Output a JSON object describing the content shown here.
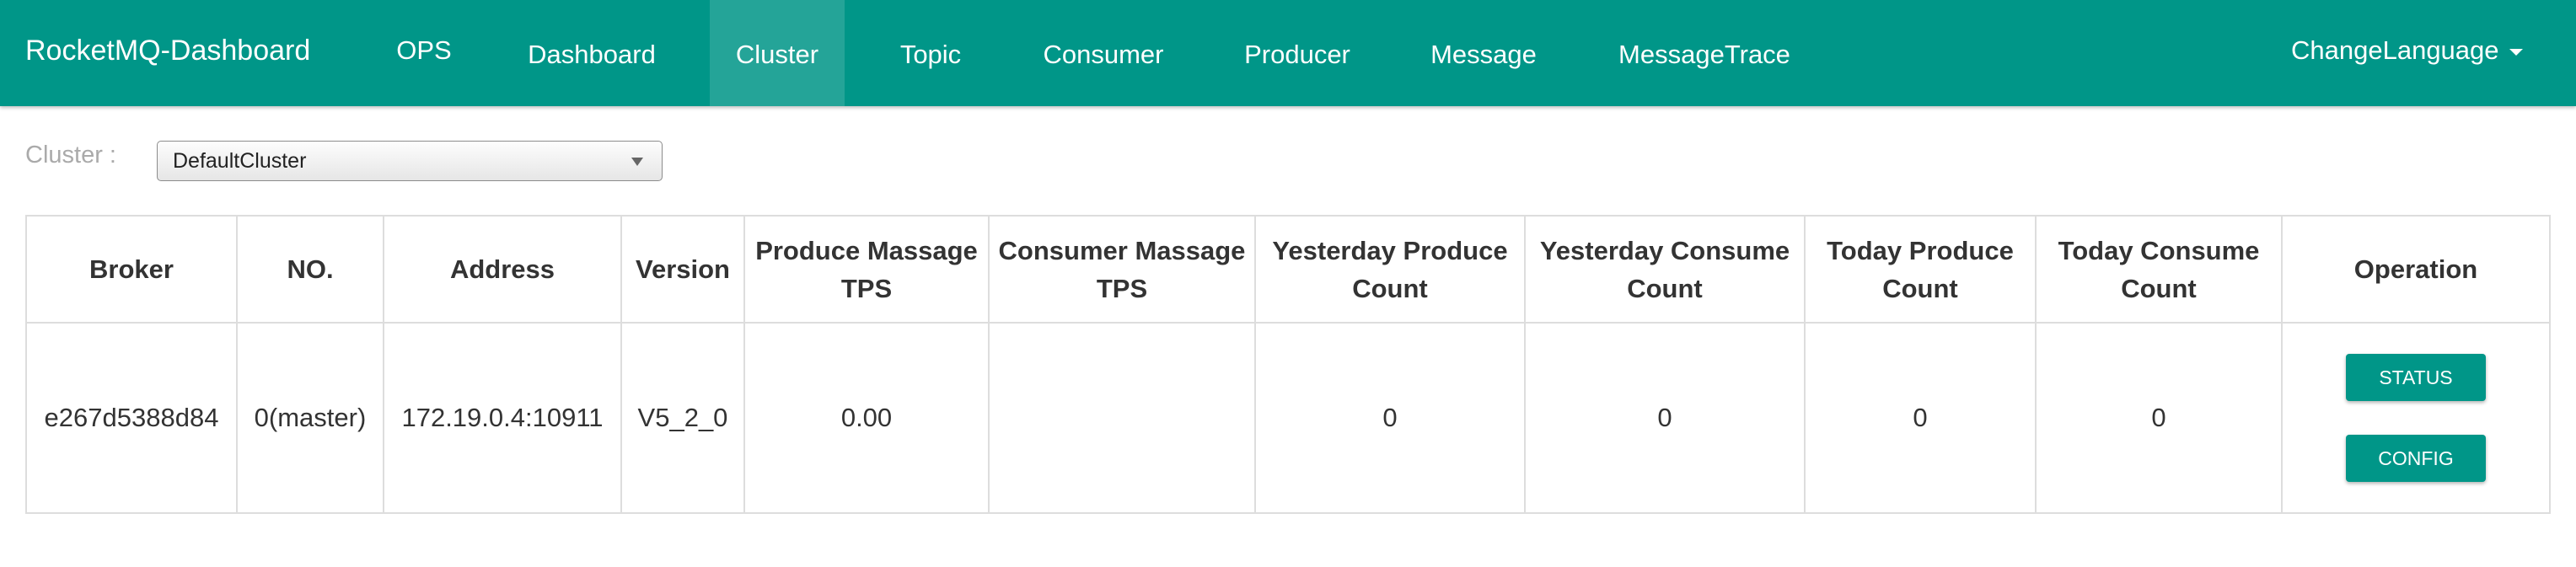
{
  "app": {
    "title": "RocketMQ-Dashboard"
  },
  "nav": {
    "items": [
      {
        "label": "OPS",
        "active": false
      },
      {
        "label": "Dashboard",
        "active": false
      },
      {
        "label": "Cluster",
        "active": true
      },
      {
        "label": "Topic",
        "active": false
      },
      {
        "label": "Consumer",
        "active": false
      },
      {
        "label": "Producer",
        "active": false
      },
      {
        "label": "Message",
        "active": false
      },
      {
        "label": "MessageTrace",
        "active": false
      }
    ],
    "language_label": "ChangeLanguage"
  },
  "filter": {
    "label": "Cluster :",
    "selected": "DefaultCluster"
  },
  "table": {
    "headers": [
      "Broker",
      "NO.",
      "Address",
      "Version",
      "Produce Massage TPS",
      "Consumer Massage TPS",
      "Yesterday Produce Count",
      "Yesterday Consume Count",
      "Today Produce Count",
      "Today Consume Count",
      "Operation"
    ],
    "rows": [
      {
        "broker": "e267d5388d84",
        "no": "0(master)",
        "address": "172.19.0.4:10911",
        "version": "V5_2_0",
        "produce_tps": "0.00",
        "consumer_tps": "",
        "yesterday_produce": "0",
        "yesterday_consume": "0",
        "today_produce": "0",
        "today_consume": "0",
        "status_label": "STATUS",
        "config_label": "CONFIG"
      }
    ]
  },
  "colors": {
    "primary": "#009688",
    "border": "#dddddd"
  }
}
